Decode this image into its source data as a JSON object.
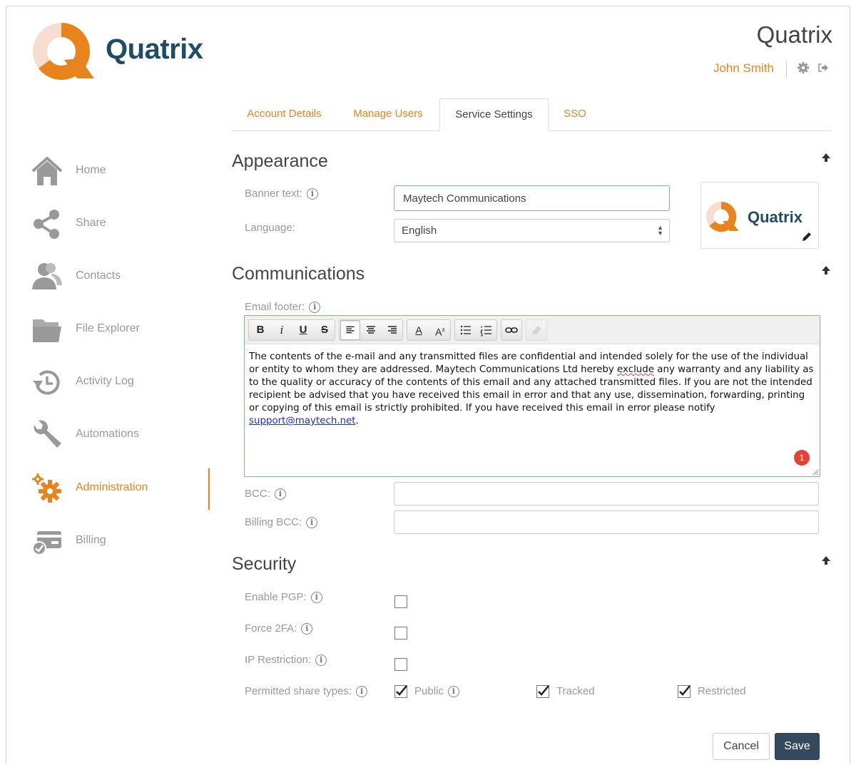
{
  "brand": {
    "name": "Quatrix",
    "accent_color": "#e8841e",
    "dark_color": "#1f4d66"
  },
  "header": {
    "title": "Quatrix",
    "user_name": "John Smith",
    "icons": [
      "gear-icon",
      "logout-icon"
    ]
  },
  "tabs": [
    {
      "label": "Account Details",
      "active": false
    },
    {
      "label": "Manage Users",
      "active": false
    },
    {
      "label": "Service Settings",
      "active": true
    },
    {
      "label": "SSO",
      "active": false
    }
  ],
  "sidebar": {
    "items": [
      {
        "label": "Home",
        "icon": "home-icon"
      },
      {
        "label": "Share",
        "icon": "share-icon"
      },
      {
        "label": "Contacts",
        "icon": "contacts-icon"
      },
      {
        "label": "File Explorer",
        "icon": "folder-icon"
      },
      {
        "label": "Activity Log",
        "icon": "history-icon"
      },
      {
        "label": "Automations",
        "icon": "wrench-icon"
      },
      {
        "label": "Administration",
        "icon": "gears-icon",
        "active": true
      },
      {
        "label": "Billing",
        "icon": "billing-icon"
      }
    ]
  },
  "appearance": {
    "title": "Appearance",
    "banner_label": "Banner text:",
    "banner_value": "Maytech Communications",
    "language_label": "Language:",
    "language_value": "English",
    "logo_text": "Quatrix"
  },
  "communications": {
    "title": "Communications",
    "footer_label": "Email footer:",
    "footer_text_1": "The contents of the e-mail and any transmitted files are confidential and intended solely for the use of the individual or entity to whom they are addressed. Maytech Communications Ltd hereby ",
    "footer_spell_word": "exclude",
    "footer_text_2": " any warranty and any liability as to the quality or accuracy of the contents of this email and any attached transmitted files. If you are not the intended recipient be advised that you have received this email in error and that any use, dissemination, forwarding, printing or copying of this email is strictly prohibited. If you have received this email in error please notify ",
    "footer_link": "support@maytech.net",
    "footer_text_3": ".",
    "badge_count": "1",
    "bcc_label": "BCC:",
    "bcc_value": "",
    "billing_bcc_label": "Billing BCC:",
    "billing_bcc_value": ""
  },
  "security": {
    "title": "Security",
    "pgp_label": "Enable PGP:",
    "pgp_checked": false,
    "twofa_label": "Force 2FA:",
    "twofa_checked": false,
    "ip_label": "IP Restriction:",
    "ip_checked": false,
    "share_types_label": "Permitted share types:",
    "share_types": [
      {
        "label": "Public",
        "checked": true
      },
      {
        "label": "Tracked",
        "checked": true
      },
      {
        "label": "Restricted",
        "checked": true
      }
    ]
  },
  "actions": {
    "cancel_label": "Cancel",
    "save_label": "Save"
  }
}
